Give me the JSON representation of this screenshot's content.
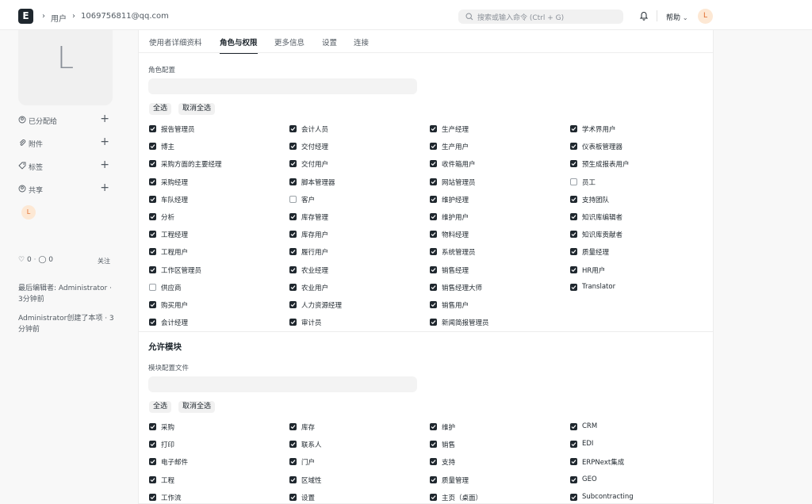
{
  "navbar": {
    "logo": "E",
    "breadcrumbs": [
      "用户",
      "1069756811@qq.com"
    ],
    "search_placeholder": "搜索或输入命令 (Ctrl + G)",
    "help_label": "帮助",
    "avatar_initial": "L"
  },
  "sidebar": {
    "avatar_initial": "L",
    "items": [
      {
        "label": "已分配给",
        "icon": "assign-icon"
      },
      {
        "label": "附件",
        "icon": "paperclip-icon"
      },
      {
        "label": "标签",
        "icon": "tag-icon"
      },
      {
        "label": "共享",
        "icon": "share-icon"
      }
    ],
    "shared_user_initial": "L",
    "likes": "0",
    "comments": "0",
    "follow_label": "关注",
    "last_edited": "最后编辑者: Administrator · 3分钟前",
    "created": "Administrator创建了本项 · 3分钟前"
  },
  "tabs": [
    {
      "label": "使用者详细资料",
      "active": false
    },
    {
      "label": "角色与权限",
      "active": true
    },
    {
      "label": "更多信息",
      "active": false
    },
    {
      "label": "设置",
      "active": false
    },
    {
      "label": "连接",
      "active": false
    }
  ],
  "roles": {
    "field_label": "角色配置",
    "select_all": "全选",
    "deselect_all": "取消全选",
    "columns": [
      [
        {
          "label": "报告管理员",
          "checked": true
        },
        {
          "label": "博主",
          "checked": true
        },
        {
          "label": "采购方面的主要经理",
          "checked": true
        },
        {
          "label": "采购经理",
          "checked": true
        },
        {
          "label": "车队经理",
          "checked": true
        },
        {
          "label": "分析",
          "checked": true
        },
        {
          "label": "工程经理",
          "checked": true
        },
        {
          "label": "工程用户",
          "checked": true
        },
        {
          "label": "工作区管理员",
          "checked": true
        },
        {
          "label": "供应商",
          "checked": false
        },
        {
          "label": "购买用户",
          "checked": true
        },
        {
          "label": "会计经理",
          "checked": true
        }
      ],
      [
        {
          "label": "会计人员",
          "checked": true
        },
        {
          "label": "交付经理",
          "checked": true
        },
        {
          "label": "交付用户",
          "checked": true
        },
        {
          "label": "脚本管理器",
          "checked": true
        },
        {
          "label": "客户",
          "checked": false
        },
        {
          "label": "库存管理",
          "checked": true
        },
        {
          "label": "库存用户",
          "checked": true
        },
        {
          "label": "履行用户",
          "checked": true
        },
        {
          "label": "农业经理",
          "checked": true
        },
        {
          "label": "农业用户",
          "checked": true
        },
        {
          "label": "人力资源经理",
          "checked": true
        },
        {
          "label": "审计员",
          "checked": true
        }
      ],
      [
        {
          "label": "生产经理",
          "checked": true
        },
        {
          "label": "生产用户",
          "checked": true
        },
        {
          "label": "收件箱用户",
          "checked": true
        },
        {
          "label": "网站管理员",
          "checked": true
        },
        {
          "label": "维护经理",
          "checked": true
        },
        {
          "label": "维护用户",
          "checked": true
        },
        {
          "label": "物料经理",
          "checked": true
        },
        {
          "label": "系统管理员",
          "checked": true
        },
        {
          "label": "销售经理",
          "checked": true
        },
        {
          "label": "销售经理大师",
          "checked": true
        },
        {
          "label": "销售用户",
          "checked": true
        },
        {
          "label": "新闻简报管理员",
          "checked": true
        }
      ],
      [
        {
          "label": "学术界用户",
          "checked": true
        },
        {
          "label": "仪表板管理器",
          "checked": true
        },
        {
          "label": "预生成报表用户",
          "checked": true
        },
        {
          "label": "员工",
          "checked": false
        },
        {
          "label": "支持团队",
          "checked": true
        },
        {
          "label": "知识库编辑者",
          "checked": true
        },
        {
          "label": "知识库贡献者",
          "checked": true
        },
        {
          "label": "质量经理",
          "checked": true
        },
        {
          "label": "HR用户",
          "checked": true
        },
        {
          "label": "Translator",
          "checked": true
        }
      ]
    ]
  },
  "modules": {
    "section_title": "允许模块",
    "field_label": "模块配置文件",
    "select_all": "全选",
    "deselect_all": "取消全选",
    "columns": [
      [
        {
          "label": "采购",
          "checked": true
        },
        {
          "label": "打印",
          "checked": true
        },
        {
          "label": "电子邮件",
          "checked": true
        },
        {
          "label": "工程",
          "checked": true
        },
        {
          "label": "工作流",
          "checked": true
        }
      ],
      [
        {
          "label": "库存",
          "checked": true
        },
        {
          "label": "联系人",
          "checked": true
        },
        {
          "label": "门户",
          "checked": true
        },
        {
          "label": "区域性",
          "checked": true
        },
        {
          "label": "设置",
          "checked": true
        }
      ],
      [
        {
          "label": "维护",
          "checked": true
        },
        {
          "label": "销售",
          "checked": true
        },
        {
          "label": "支持",
          "checked": true
        },
        {
          "label": "质量管理",
          "checked": true
        },
        {
          "label": "主页（桌面）",
          "checked": true
        }
      ],
      [
        {
          "label": "CRM",
          "checked": true
        },
        {
          "label": "EDI",
          "checked": true
        },
        {
          "label": "ERPNext集成",
          "checked": true
        },
        {
          "label": "GEO",
          "checked": true
        },
        {
          "label": "Subcontracting",
          "checked": true
        }
      ]
    ]
  }
}
